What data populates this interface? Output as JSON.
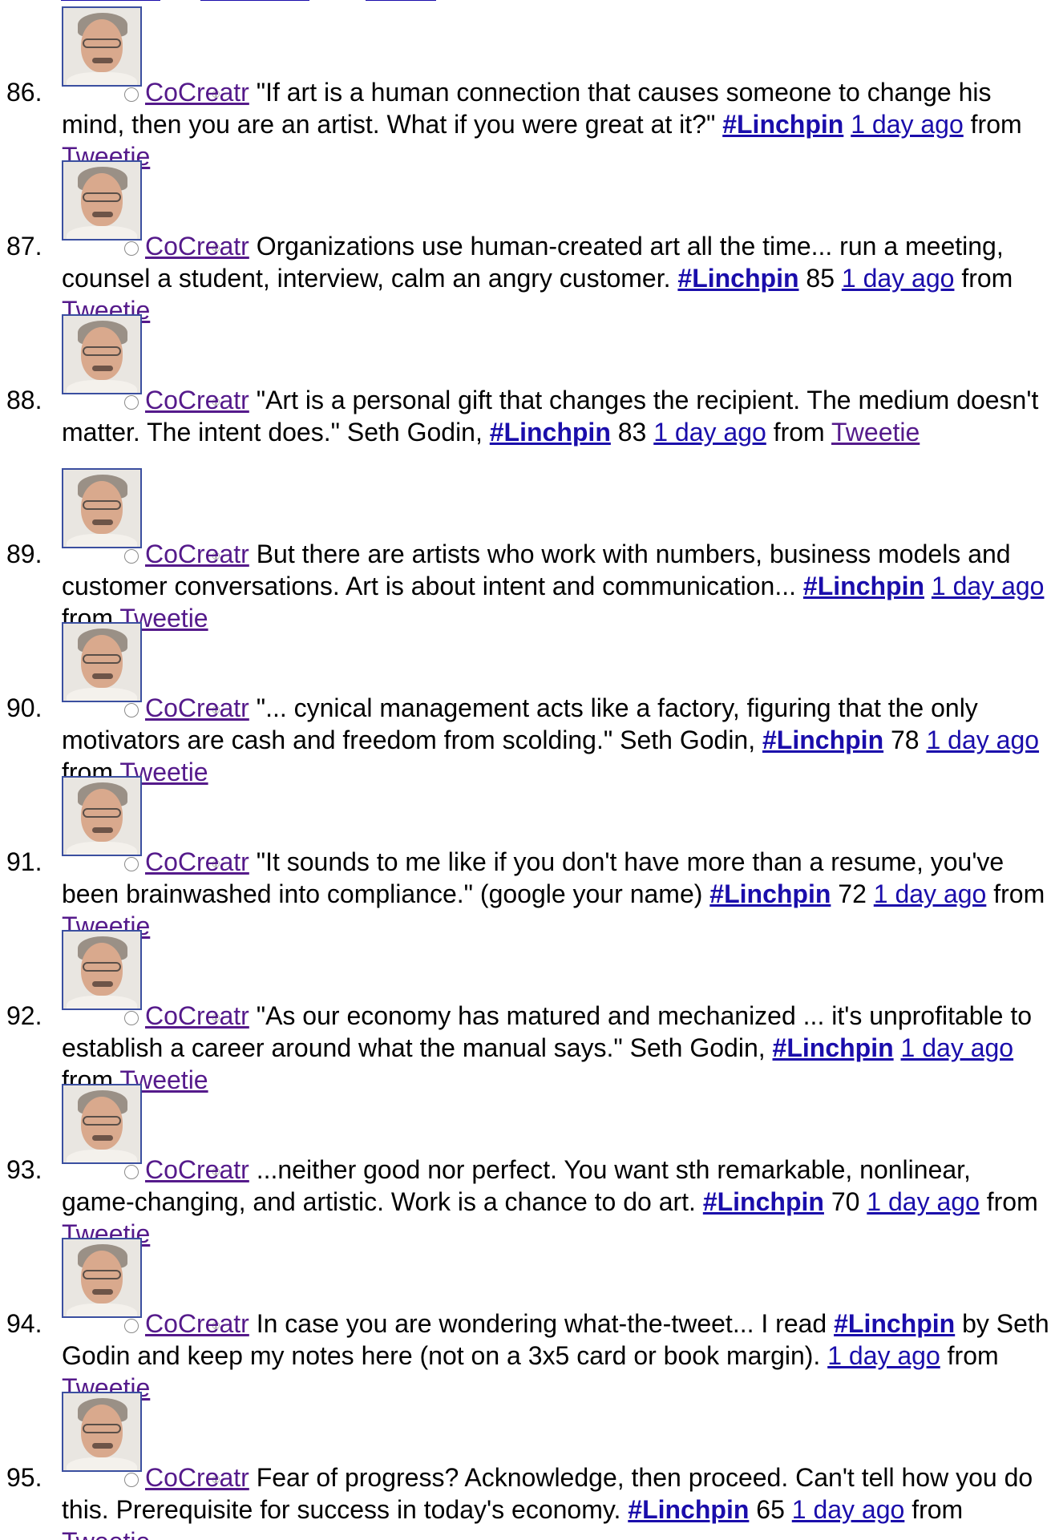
{
  "tweets": [
    {
      "number": "86.",
      "user": "CoCreatr",
      "text_before": "\"If art is a human connection that causes someone to change his mind, then you are an artist. What if you were great at it?\"",
      "hashtag": "#Linchpin",
      "text_after": "",
      "time": "1 day ago",
      "from_label": "from",
      "source": "Tweetie"
    },
    {
      "number": "87.",
      "user": "CoCreatr",
      "text_before": "Organizations use human-created art all the time... run a meeting, counsel a student, interview, calm an angry customer.",
      "hashtag": "#Linchpin",
      "text_after": "85",
      "time": "1 day ago",
      "from_label": "from",
      "source": "Tweetie"
    },
    {
      "number": "88.",
      "user": "CoCreatr",
      "text_before": "\"Art is a personal gift that changes the recipient. The medium doesn't matter. The intent does.\" Seth Godin,",
      "hashtag": "#Linchpin",
      "text_after": "83",
      "time": "1 day ago",
      "from_label": "from",
      "source": "Tweetie"
    },
    {
      "number": "89.",
      "user": "CoCreatr",
      "text_before": "But there are artists who work with numbers, business models and customer conversations. Art is about intent and communication...",
      "hashtag": "#Linchpin",
      "text_after": "",
      "time": "1 day ago",
      "from_label": "from",
      "source": "Tweetie"
    },
    {
      "number": "90.",
      "user": "CoCreatr",
      "text_before": "\"... cynical management acts like a factory, figuring that the only motivators are cash and freedom from scolding.\" Seth Godin,",
      "hashtag": "#Linchpin",
      "text_after": "78",
      "time": "1 day ago",
      "from_label": "from",
      "source": "Tweetie"
    },
    {
      "number": "91.",
      "user": "CoCreatr",
      "text_before": "\"It sounds to me like if you don't have more than a resume, you've been brainwashed into compliance.\" (google your name)",
      "hashtag": "#Linchpin",
      "text_after": "72",
      "time": "1 day ago",
      "from_label": "from",
      "source": "Tweetie"
    },
    {
      "number": "92.",
      "user": "CoCreatr",
      "text_before": "\"As our economy has matured and mechanized ... it's unprofitable to establish a career around what the manual says.\" Seth Godin,",
      "hashtag": "#Linchpin",
      "text_after": "",
      "time": "1 day ago",
      "from_label": "from",
      "source": "Tweetie"
    },
    {
      "number": "93.",
      "user": "CoCreatr",
      "text_before": "...neither good nor perfect. You want sth remarkable, nonlinear, game-changing, and artistic. Work is a chance to do art.",
      "hashtag": "#Linchpin",
      "text_after": "70",
      "time": "1 day ago",
      "from_label": "from",
      "source": "Tweetie"
    },
    {
      "number": "94.",
      "user": "CoCreatr",
      "text_before": "In case you are wondering what-the-tweet... I read",
      "hashtag": "#Linchpin",
      "text_after": "by Seth Godin and keep my notes here (not on a 3x5 card or book margin).",
      "time": "1 day ago",
      "from_label": "from",
      "source": "Tweetie"
    },
    {
      "number": "95.",
      "user": "CoCreatr",
      "text_before": "Fear of progress? Acknowledge, then proceed. Can't tell how you do this. Prerequisite for success in today's economy.",
      "hashtag": "#Linchpin",
      "text_after": "65",
      "time": "1 day ago",
      "from_label": "from",
      "source": "Tweetie"
    }
  ],
  "avatar_icon": "user-photo-icon",
  "badge_icon": "info-icon",
  "badge_glyph": "①"
}
